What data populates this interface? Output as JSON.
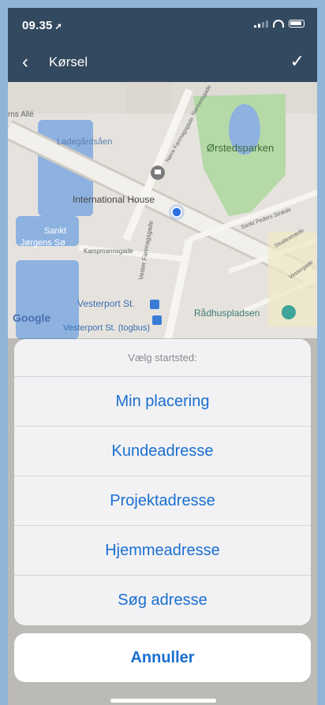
{
  "status_bar": {
    "time": "09.35"
  },
  "nav": {
    "title": "Kørsel"
  },
  "map": {
    "labels": {
      "street_top_left": "rns Allé",
      "lake_1": "Ladegårdsåen",
      "park": "Ørstedsparken",
      "poi_international": "International House",
      "lake_2_line1": "Sankt",
      "lake_2_line2": "Jørgens Sø",
      "street_kampmann": "Kampmannsgade",
      "street_vester": "Vester Farimagsgade",
      "street_sankt_peders": "Sankt Peders Stræde",
      "street_studie": "Studiestræde",
      "station_1": "Vesterport St.",
      "station_2": "Vesterport St. (togbus)",
      "square": "Rådhuspladsen",
      "street_noerre": "Nørre Farimagsgade",
      "street_nansen": "Nansensgade",
      "street_vesterv": "Vestergade"
    },
    "attribution": "Google"
  },
  "action_sheet": {
    "header": "Vælg startsted:",
    "options": [
      "Min placering",
      "Kundeadresse",
      "Projektadresse",
      "Hjemmeadresse",
      "Søg adresse"
    ],
    "cancel": "Annuller"
  }
}
